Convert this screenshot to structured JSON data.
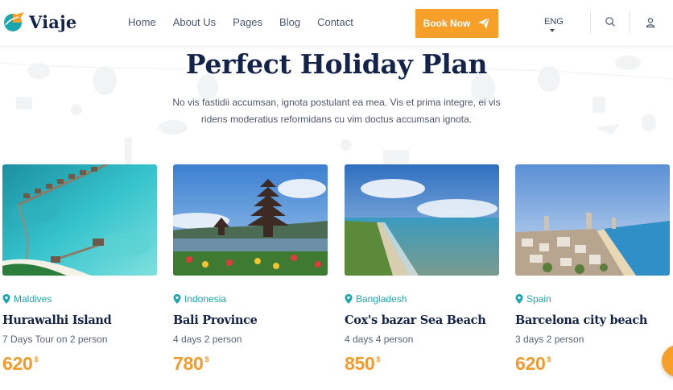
{
  "brand": {
    "name": "Viaje"
  },
  "nav": [
    {
      "label": "Home"
    },
    {
      "label": "About Us"
    },
    {
      "label": "Pages"
    },
    {
      "label": "Blog"
    },
    {
      "label": "Contact"
    }
  ],
  "header": {
    "book_label": "Book Now",
    "language": "ENG",
    "icons": [
      "search-icon",
      "user-icon"
    ]
  },
  "hero": {
    "title": "Perfect Holiday Plan",
    "subtitle": "No vis fastidii accumsan, ignota postulant ea mea. Vis et prima integre, ei vis ridens moderatius reformidans cu vim doctus accumsan ignota."
  },
  "tours": [
    {
      "location": "Maldives",
      "title": "Hurawalhi Island",
      "meta": "7 Days Tour on 2 person",
      "price": "620",
      "currency": "$"
    },
    {
      "location": "Indonesia",
      "title": "Bali Province",
      "meta": "4 days 2 person",
      "price": "780",
      "currency": "$"
    },
    {
      "location": "Bangladesh",
      "title": "Cox's bazar Sea Beach",
      "meta": "4 days 4 person",
      "price": "850",
      "currency": "$"
    },
    {
      "location": "Spain",
      "title": "Barcelona city beach",
      "meta": "3 days 2 person",
      "price": "620",
      "currency": "$"
    }
  ],
  "colors": {
    "accent": "#f6a02a",
    "teal": "#1aa7ad",
    "navy": "#14234a"
  }
}
